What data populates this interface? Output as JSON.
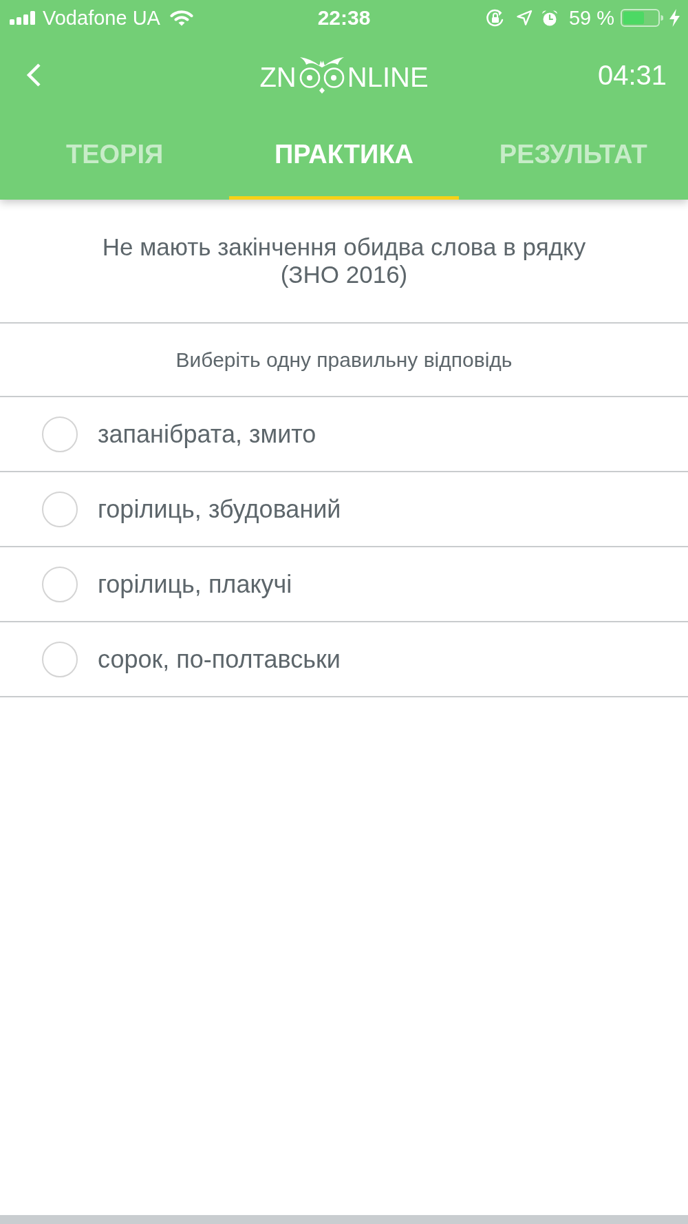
{
  "status_bar": {
    "carrier": "Vodafone UA",
    "time": "22:38",
    "battery_percent": "59 %"
  },
  "header": {
    "logo": {
      "left": "ZN",
      "right": "NLINE"
    },
    "timer": "04:31"
  },
  "tabs": [
    {
      "label": "ТЕОРІЯ",
      "selected": false
    },
    {
      "label": "ПРАКТИКА",
      "selected": true
    },
    {
      "label": "РЕЗУЛЬТАТ",
      "selected": false
    }
  ],
  "question": "Не мають закінчення обидва слова в рядку (ЗНО 2016)",
  "instruction": "Виберіть одну правильну відповідь",
  "options": [
    {
      "text": "запанібрата, змито",
      "selected": false
    },
    {
      "text": "горілиць, збудований",
      "selected": false
    },
    {
      "text": "горілиць, плакучі",
      "selected": false
    },
    {
      "text": "сорок, по-полтавськи",
      "selected": false
    }
  ]
}
